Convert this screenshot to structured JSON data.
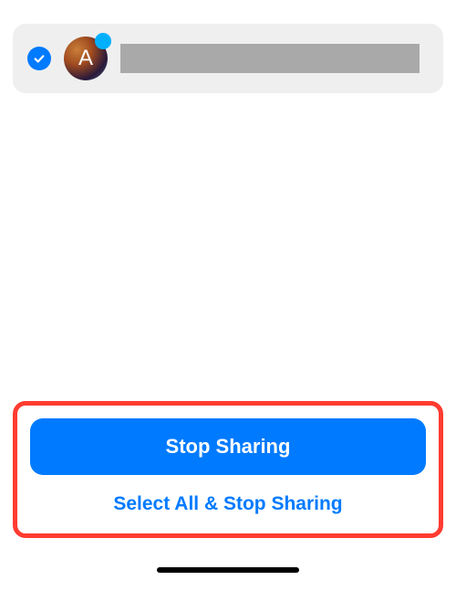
{
  "contact": {
    "selected": true,
    "avatar_letter": "A"
  },
  "actions": {
    "stop_sharing_label": "Stop Sharing",
    "select_all_stop_label": "Select All & Stop Sharing"
  }
}
